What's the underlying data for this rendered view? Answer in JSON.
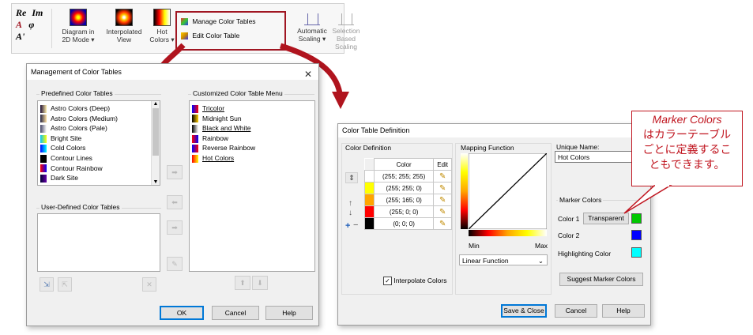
{
  "ribbon": {
    "math_labels": [
      "Re",
      "Im",
      "A",
      "φ",
      "A'"
    ],
    "diagram_2d": [
      "Diagram in",
      "2D Mode ▾"
    ],
    "interpolated": [
      "Interpolated",
      "View"
    ],
    "hot_colors": [
      "Hot",
      "Colors ▾"
    ],
    "manage_color_tables": "Manage Color Tables",
    "edit_color_table": "Edit Color Table",
    "automatic_scaling": [
      "Automatic",
      "Scaling ▾"
    ],
    "selection_scaling": [
      "Selection",
      "Based Scaling"
    ]
  },
  "management": {
    "title": "Management of Color Tables",
    "predefined_title": "Predefined Color Tables",
    "predefined_items": [
      {
        "label": "Astro Colors (Deep)",
        "colors": [
          "#1a0a33",
          "#ffeeaa"
        ]
      },
      {
        "label": "Astro Colors (Medium)",
        "colors": [
          "#222244",
          "#ffe0a0"
        ]
      },
      {
        "label": "Astro Colors (Pale)",
        "colors": [
          "#444466",
          "#ffffff"
        ]
      },
      {
        "label": "Bright Site",
        "colors": [
          "#00c0ff",
          "#ffff00"
        ]
      },
      {
        "label": "Cold Colors",
        "colors": [
          "#0000ff",
          "#00ffff"
        ]
      },
      {
        "label": "Contour Lines",
        "colors": [
          "#000000",
          "#000000"
        ]
      },
      {
        "label": "Contour Rainbow",
        "colors": [
          "#ff0000",
          "#0000ff"
        ]
      },
      {
        "label": "Dark Site",
        "colors": [
          "#000033",
          "#6600aa"
        ]
      }
    ],
    "user_defined_title": "User-Defined Color Tables",
    "customized_title": "Customized Color Table Menu",
    "customized_items": [
      {
        "label": "Tricolor",
        "underline": true,
        "colors": [
          "#0000ff",
          "#ff0000"
        ]
      },
      {
        "label": "Midnight Sun",
        "underline": false,
        "colors": [
          "#000000",
          "#ffcc00"
        ]
      },
      {
        "label": "Black and White",
        "underline": true,
        "colors": [
          "#000000",
          "#ffffff"
        ]
      },
      {
        "label": "Rainbow",
        "underline": false,
        "colors": [
          "#ff0000",
          "#0000ff"
        ]
      },
      {
        "label": "Reverse Rainbow",
        "underline": false,
        "colors": [
          "#0000ff",
          "#ff0000"
        ]
      },
      {
        "label": "Hot Colors",
        "underline": true,
        "colors": [
          "#ff0000",
          "#ffff00"
        ]
      }
    ],
    "ok": "OK",
    "cancel": "Cancel",
    "help": "Help"
  },
  "definition": {
    "title": "Color Table Definition",
    "color_definition_title": "Color Definition",
    "table_headers": [
      "Color",
      "Edit"
    ],
    "rows": [
      {
        "value": "(255; 255; 255)",
        "swatch": "#ffffff"
      },
      {
        "value": "(255; 255; 0)",
        "swatch": "#ffff00"
      },
      {
        "value": "(255; 165; 0)",
        "swatch": "#ffa500"
      },
      {
        "value": "(255; 0; 0)",
        "swatch": "#ff0000"
      },
      {
        "value": "(0; 0; 0)",
        "swatch": "#000000"
      }
    ],
    "interpolate_label": "Interpolate Colors",
    "interpolate_checked": true,
    "mapping_title": "Mapping Function",
    "min_label": "Min",
    "max_label": "Max",
    "mapping_select": "Linear Function",
    "unique_name_title": "Unique Name:",
    "unique_name_value": "Hot Colors",
    "marker_colors_title": "Marker Colors",
    "color1_label": "Color 1",
    "transparent_label": "Transparent",
    "color1_swatch": "#00c800",
    "color2_label": "Color 2",
    "color2_swatch": "#0000ff",
    "highlight_label": "Highlighting Color",
    "highlight_swatch": "#00ffff",
    "suggest_label": "Suggest Marker Colors",
    "save_close": "Save & Close",
    "cancel": "Cancel",
    "help": "Help"
  },
  "callout": {
    "lines": [
      "Marker  Colors",
      "はカラーテーブル",
      "ごとに定義するこ",
      "ともできます。"
    ]
  },
  "colors": {
    "accent_red": "#a01622",
    "dialog_bg": "#f0f0f0",
    "default_button_border": "#0078d7"
  }
}
